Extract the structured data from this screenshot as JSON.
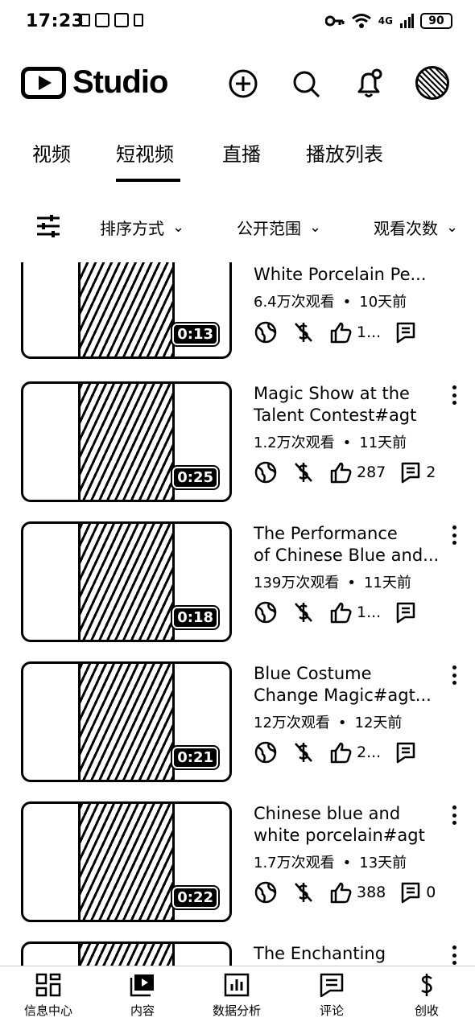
{
  "status": {
    "time": "17:23",
    "battery": "90",
    "network": "4G"
  },
  "app": {
    "title": "Studio"
  },
  "tabs": [
    {
      "label": "视频"
    },
    {
      "label": "短视频"
    },
    {
      "label": "直播"
    },
    {
      "label": "播放列表"
    }
  ],
  "filters": [
    {
      "label": "排序方式"
    },
    {
      "label": "公开范围"
    },
    {
      "label": "观看次数"
    }
  ],
  "videos": [
    {
      "title1": "White Porcelain Pe...",
      "title2": "",
      "views": "6.4万次观看",
      "age": "10天前",
      "likes": "1...",
      "comments": "",
      "duration": "0:13"
    },
    {
      "title1": "Magic Show at the",
      "title2": "Talent Contest#agt",
      "views": "1.2万次观看",
      "age": "11天前",
      "likes": "287",
      "comments": "2",
      "duration": "0:25"
    },
    {
      "title1": "The Performance",
      "title2": "of Chinese Blue and...",
      "views": "139万次观看",
      "age": "11天前",
      "likes": "1...",
      "comments": "",
      "duration": "0:18"
    },
    {
      "title1": "Blue Costume",
      "title2": "Change Magic#agt...",
      "views": "12万次观看",
      "age": "12天前",
      "likes": "2...",
      "comments": "",
      "duration": "0:21"
    },
    {
      "title1": "Chinese blue and",
      "title2": "white porcelain#agt",
      "views": "1.7万次观看",
      "age": "13天前",
      "likes": "388",
      "comments": "0",
      "duration": "0:22"
    },
    {
      "title1": "The Enchanting",
      "title2": "",
      "views": "",
      "age": "",
      "likes": "",
      "comments": "",
      "duration": ""
    }
  ],
  "bottom_nav": [
    {
      "label": "信息中心"
    },
    {
      "label": "内容"
    },
    {
      "label": "数据分析"
    },
    {
      "label": "评论"
    },
    {
      "label": "创收"
    }
  ]
}
